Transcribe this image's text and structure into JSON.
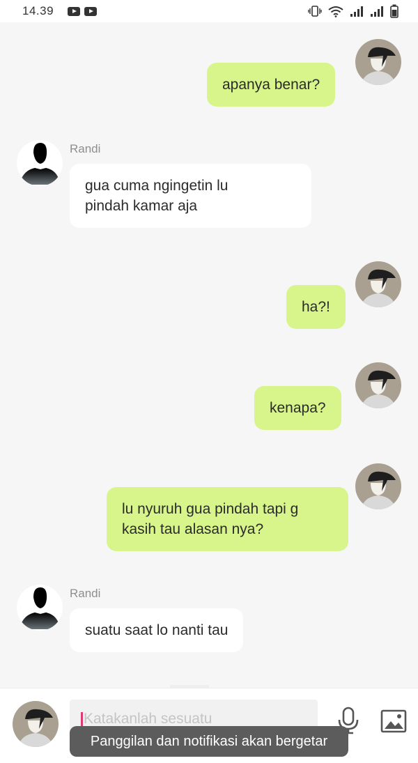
{
  "status_bar": {
    "time": "14.39",
    "icons": [
      "youtube-icon",
      "youtube-icon",
      "vibrate-icon",
      "wifi-icon",
      "signal-icon",
      "signal-icon",
      "battery-icon"
    ]
  },
  "messages": [
    {
      "direction": "out",
      "lines": [
        "apanya benar?"
      ]
    },
    {
      "direction": "in",
      "sender": "Randi",
      "lines": [
        "gua cuma ngingetin lu",
        "pindah kamar aja"
      ]
    },
    {
      "direction": "out",
      "lines": [
        "ha?!"
      ]
    },
    {
      "direction": "out",
      "lines": [
        "kenapa?"
      ]
    },
    {
      "direction": "out",
      "lines": [
        "lu nyuruh gua pindah tapi g",
        "kasih tau alasan nya?"
      ]
    },
    {
      "direction": "in",
      "sender": "Randi",
      "lines": [
        "suatu saat lo nanti tau"
      ]
    }
  ],
  "composer": {
    "placeholder": "Katakanlah sesuatu",
    "icons": [
      "microphone-icon",
      "image-icon"
    ]
  },
  "toast": "Panggilan dan notifikasi akan bergetar",
  "colors": {
    "outgoing_bubble": "#d7f58a",
    "incoming_bubble": "#ffffff",
    "background": "#f6f6f6",
    "cursor": "#e03a75",
    "toast": "#5c5c5c"
  }
}
